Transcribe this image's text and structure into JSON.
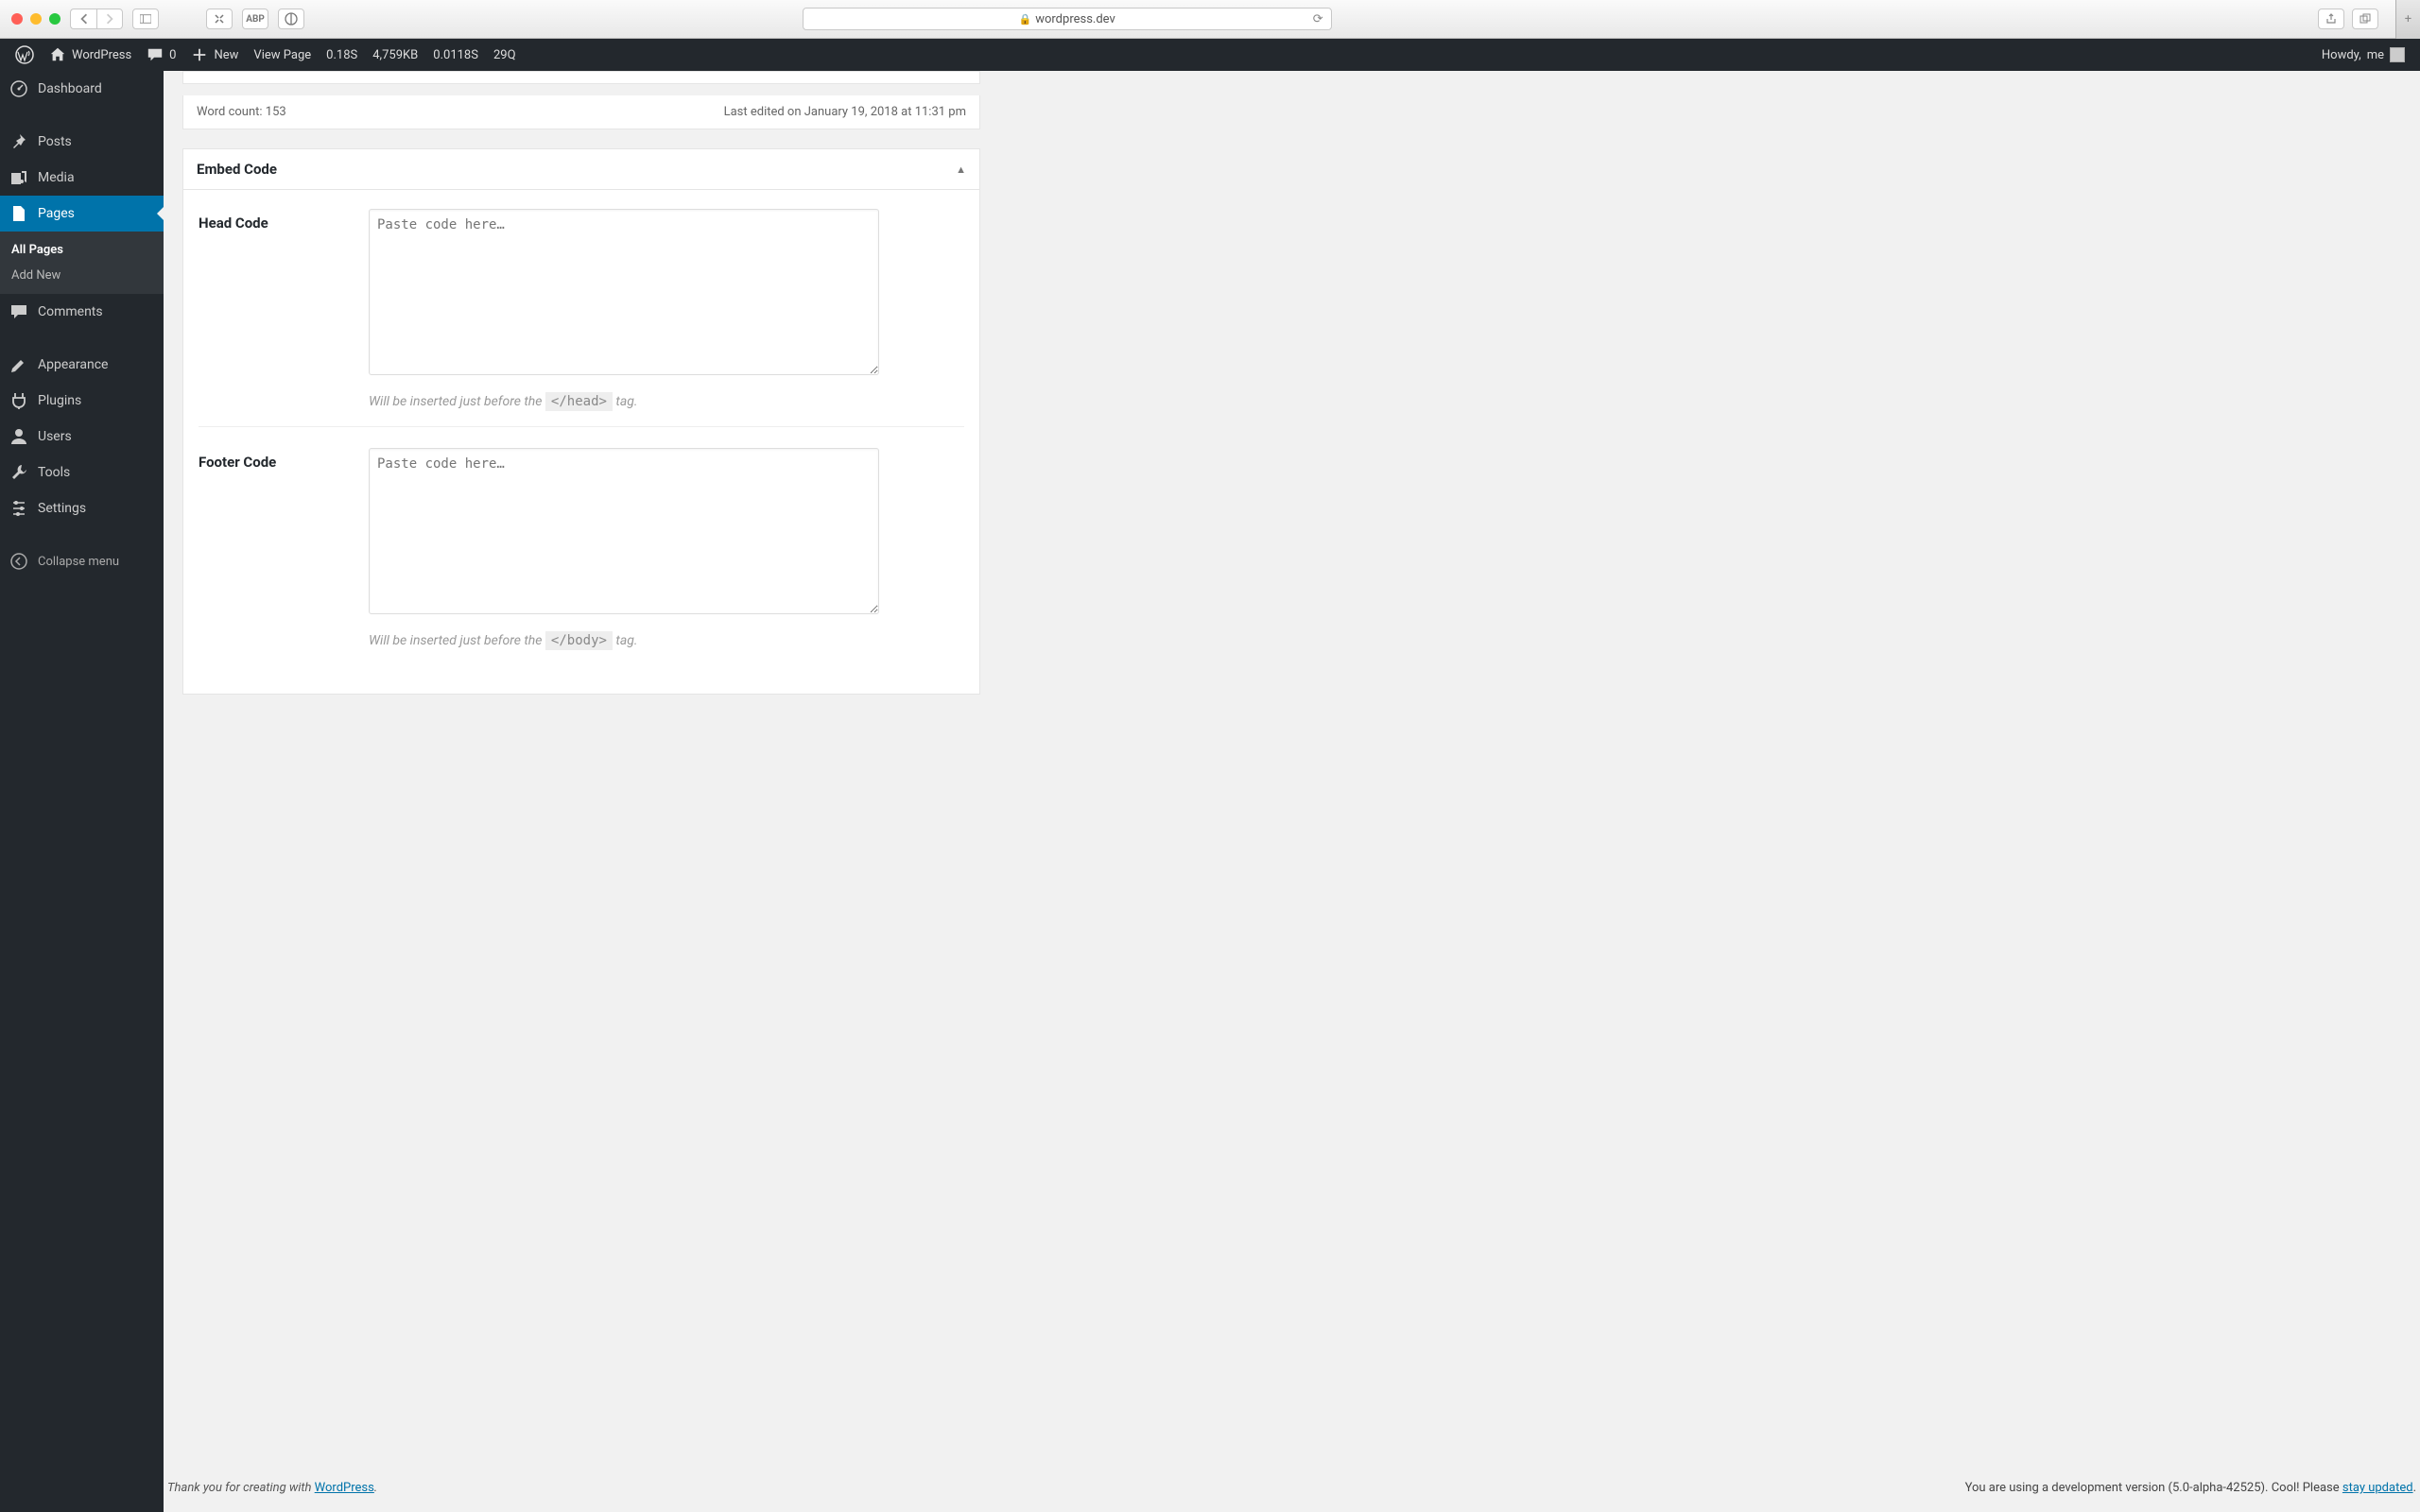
{
  "browser": {
    "url": "wordpress.dev"
  },
  "adminbar": {
    "site_name": "WordPress",
    "comments_count": "0",
    "new_label": "New",
    "view_page_label": "View Page",
    "time1": "0.18S",
    "memory": "4,759KB",
    "time2": "0.0118S",
    "queries": "29Q",
    "howdy_prefix": "Howdy, ",
    "howdy_user": "me"
  },
  "sidebar": {
    "dashboard": "Dashboard",
    "posts": "Posts",
    "media": "Media",
    "pages": "Pages",
    "pages_sub_all": "All Pages",
    "pages_sub_new": "Add New",
    "comments": "Comments",
    "appearance": "Appearance",
    "plugins": "Plugins",
    "users": "Users",
    "tools": "Tools",
    "settings": "Settings",
    "collapse": "Collapse menu"
  },
  "editor": {
    "word_count": "Word count: 153",
    "last_edited": "Last edited on January 19, 2018 at 11:31 pm"
  },
  "metabox": {
    "title": "Embed Code",
    "head_label": "Head Code",
    "head_placeholder": "Paste code here…",
    "head_help_pre": "Will be inserted just before the ",
    "head_help_tag": "</head>",
    "head_help_post": " tag.",
    "footer_label": "Footer Code",
    "footer_placeholder": "Paste code here…",
    "footer_help_pre": "Will be inserted just before the ",
    "footer_help_tag": "</body>",
    "footer_help_post": " tag."
  },
  "footer": {
    "thanks_pre": "Thank you for creating with ",
    "thanks_link": "WordPress",
    "thanks_post": ".",
    "dev_pre": "You are using a development version (5.0-alpha-42525). Cool! Please ",
    "dev_link": "stay updated",
    "dev_post": "."
  }
}
